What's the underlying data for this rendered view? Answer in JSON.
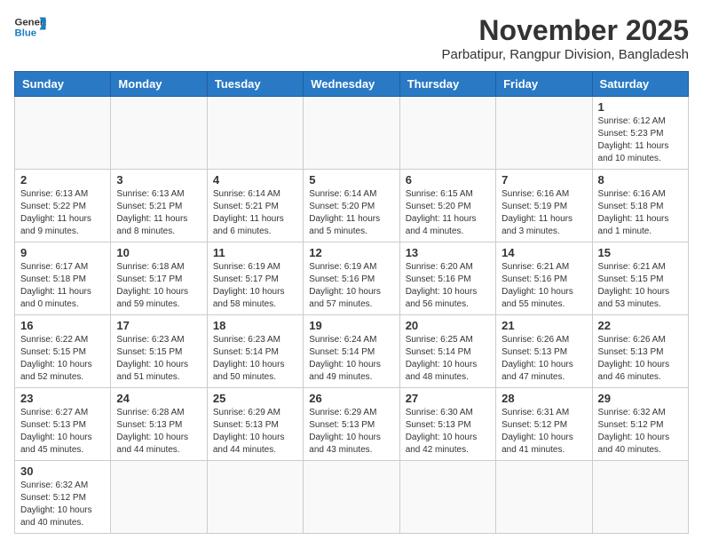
{
  "header": {
    "logo_general": "General",
    "logo_blue": "Blue",
    "month_year": "November 2025",
    "location": "Parbatipur, Rangpur Division, Bangladesh"
  },
  "weekdays": [
    "Sunday",
    "Monday",
    "Tuesday",
    "Wednesday",
    "Thursday",
    "Friday",
    "Saturday"
  ],
  "weeks": [
    [
      {
        "day": "",
        "info": ""
      },
      {
        "day": "",
        "info": ""
      },
      {
        "day": "",
        "info": ""
      },
      {
        "day": "",
        "info": ""
      },
      {
        "day": "",
        "info": ""
      },
      {
        "day": "",
        "info": ""
      },
      {
        "day": "1",
        "info": "Sunrise: 6:12 AM\nSunset: 5:23 PM\nDaylight: 11 hours\nand 10 minutes."
      }
    ],
    [
      {
        "day": "2",
        "info": "Sunrise: 6:13 AM\nSunset: 5:22 PM\nDaylight: 11 hours\nand 9 minutes."
      },
      {
        "day": "3",
        "info": "Sunrise: 6:13 AM\nSunset: 5:21 PM\nDaylight: 11 hours\nand 8 minutes."
      },
      {
        "day": "4",
        "info": "Sunrise: 6:14 AM\nSunset: 5:21 PM\nDaylight: 11 hours\nand 6 minutes."
      },
      {
        "day": "5",
        "info": "Sunrise: 6:14 AM\nSunset: 5:20 PM\nDaylight: 11 hours\nand 5 minutes."
      },
      {
        "day": "6",
        "info": "Sunrise: 6:15 AM\nSunset: 5:20 PM\nDaylight: 11 hours\nand 4 minutes."
      },
      {
        "day": "7",
        "info": "Sunrise: 6:16 AM\nSunset: 5:19 PM\nDaylight: 11 hours\nand 3 minutes."
      },
      {
        "day": "8",
        "info": "Sunrise: 6:16 AM\nSunset: 5:18 PM\nDaylight: 11 hours\nand 1 minute."
      }
    ],
    [
      {
        "day": "9",
        "info": "Sunrise: 6:17 AM\nSunset: 5:18 PM\nDaylight: 11 hours\nand 0 minutes."
      },
      {
        "day": "10",
        "info": "Sunrise: 6:18 AM\nSunset: 5:17 PM\nDaylight: 10 hours\nand 59 minutes."
      },
      {
        "day": "11",
        "info": "Sunrise: 6:19 AM\nSunset: 5:17 PM\nDaylight: 10 hours\nand 58 minutes."
      },
      {
        "day": "12",
        "info": "Sunrise: 6:19 AM\nSunset: 5:16 PM\nDaylight: 10 hours\nand 57 minutes."
      },
      {
        "day": "13",
        "info": "Sunrise: 6:20 AM\nSunset: 5:16 PM\nDaylight: 10 hours\nand 56 minutes."
      },
      {
        "day": "14",
        "info": "Sunrise: 6:21 AM\nSunset: 5:16 PM\nDaylight: 10 hours\nand 55 minutes."
      },
      {
        "day": "15",
        "info": "Sunrise: 6:21 AM\nSunset: 5:15 PM\nDaylight: 10 hours\nand 53 minutes."
      }
    ],
    [
      {
        "day": "16",
        "info": "Sunrise: 6:22 AM\nSunset: 5:15 PM\nDaylight: 10 hours\nand 52 minutes."
      },
      {
        "day": "17",
        "info": "Sunrise: 6:23 AM\nSunset: 5:15 PM\nDaylight: 10 hours\nand 51 minutes."
      },
      {
        "day": "18",
        "info": "Sunrise: 6:23 AM\nSunset: 5:14 PM\nDaylight: 10 hours\nand 50 minutes."
      },
      {
        "day": "19",
        "info": "Sunrise: 6:24 AM\nSunset: 5:14 PM\nDaylight: 10 hours\nand 49 minutes."
      },
      {
        "day": "20",
        "info": "Sunrise: 6:25 AM\nSunset: 5:14 PM\nDaylight: 10 hours\nand 48 minutes."
      },
      {
        "day": "21",
        "info": "Sunrise: 6:26 AM\nSunset: 5:13 PM\nDaylight: 10 hours\nand 47 minutes."
      },
      {
        "day": "22",
        "info": "Sunrise: 6:26 AM\nSunset: 5:13 PM\nDaylight: 10 hours\nand 46 minutes."
      }
    ],
    [
      {
        "day": "23",
        "info": "Sunrise: 6:27 AM\nSunset: 5:13 PM\nDaylight: 10 hours\nand 45 minutes."
      },
      {
        "day": "24",
        "info": "Sunrise: 6:28 AM\nSunset: 5:13 PM\nDaylight: 10 hours\nand 44 minutes."
      },
      {
        "day": "25",
        "info": "Sunrise: 6:29 AM\nSunset: 5:13 PM\nDaylight: 10 hours\nand 44 minutes."
      },
      {
        "day": "26",
        "info": "Sunrise: 6:29 AM\nSunset: 5:13 PM\nDaylight: 10 hours\nand 43 minutes."
      },
      {
        "day": "27",
        "info": "Sunrise: 6:30 AM\nSunset: 5:13 PM\nDaylight: 10 hours\nand 42 minutes."
      },
      {
        "day": "28",
        "info": "Sunrise: 6:31 AM\nSunset: 5:12 PM\nDaylight: 10 hours\nand 41 minutes."
      },
      {
        "day": "29",
        "info": "Sunrise: 6:32 AM\nSunset: 5:12 PM\nDaylight: 10 hours\nand 40 minutes."
      }
    ],
    [
      {
        "day": "30",
        "info": "Sunrise: 6:32 AM\nSunset: 5:12 PM\nDaylight: 10 hours\nand 40 minutes."
      },
      {
        "day": "",
        "info": ""
      },
      {
        "day": "",
        "info": ""
      },
      {
        "day": "",
        "info": ""
      },
      {
        "day": "",
        "info": ""
      },
      {
        "day": "",
        "info": ""
      },
      {
        "day": "",
        "info": ""
      }
    ]
  ]
}
